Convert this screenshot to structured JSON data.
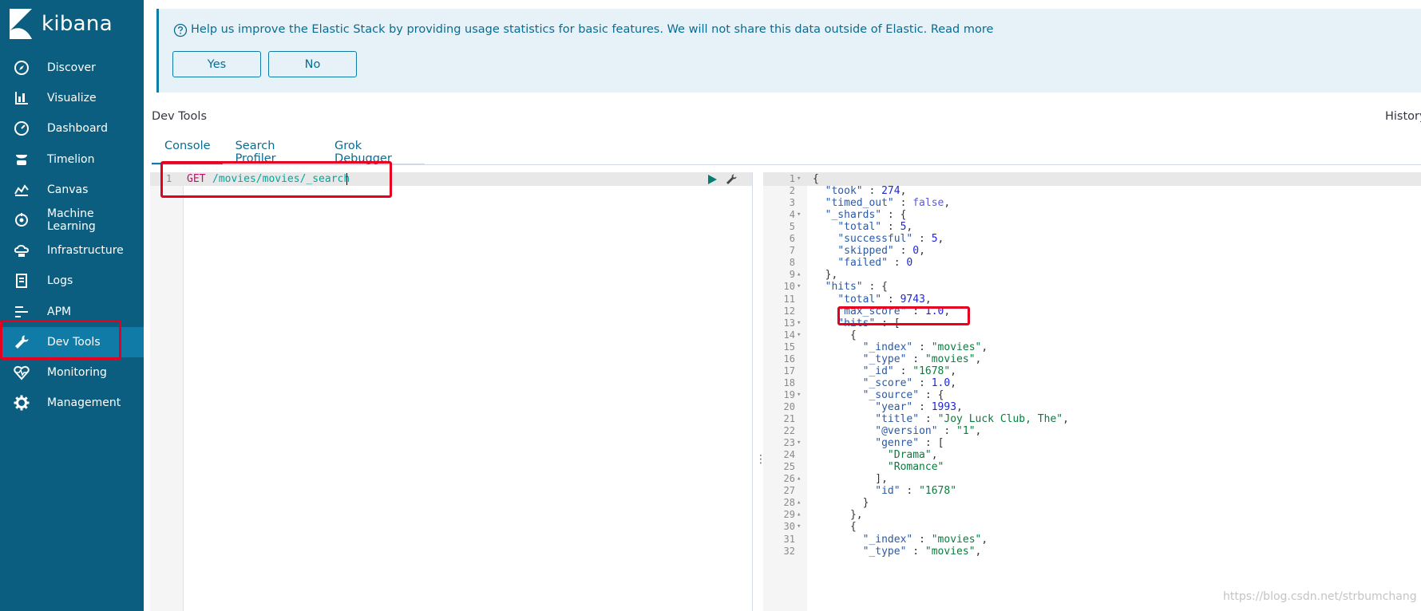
{
  "sidebar": {
    "brand": "kibana",
    "items": [
      {
        "label": "Discover",
        "icon": "compass-icon"
      },
      {
        "label": "Visualize",
        "icon": "bar-chart-icon"
      },
      {
        "label": "Dashboard",
        "icon": "gauge-icon"
      },
      {
        "label": "Timelion",
        "icon": "timelion-icon"
      },
      {
        "label": "Canvas",
        "icon": "canvas-icon"
      },
      {
        "label": "Machine Learning",
        "icon": "machine-learning-icon"
      },
      {
        "label": "Infrastructure",
        "icon": "infrastructure-icon"
      },
      {
        "label": "Logs",
        "icon": "logs-icon"
      },
      {
        "label": "APM",
        "icon": "apm-icon"
      },
      {
        "label": "Dev Tools",
        "icon": "wrench-icon",
        "active": true
      },
      {
        "label": "Monitoring",
        "icon": "heartbeat-icon"
      },
      {
        "label": "Management",
        "icon": "gear-icon"
      }
    ]
  },
  "banner": {
    "message": "Help us improve the Elastic Stack by providing usage statistics for basic features. We will not share this data outside of Elastic. Read more",
    "yes_label": "Yes",
    "no_label": "No"
  },
  "header": {
    "title": "Dev Tools",
    "history_label": "History"
  },
  "tabs": [
    "Console",
    "Search Profiler",
    "Grok Debugger"
  ],
  "request": {
    "line_number": "1",
    "method": "GET",
    "path": "/movies/movies/_search"
  },
  "response_lines": [
    "{",
    "  \"took\" : 274,",
    "  \"timed_out\" : false,",
    "  \"_shards\" : {",
    "    \"total\" : 5,",
    "    \"successful\" : 5,",
    "    \"skipped\" : 0,",
    "    \"failed\" : 0",
    "  },",
    "  \"hits\" : {",
    "    \"total\" : 9743,",
    "    \"max_score\" : 1.0,",
    "    \"hits\" : [",
    "      {",
    "        \"_index\" : \"movies\",",
    "        \"_type\" : \"movies\",",
    "        \"_id\" : \"1678\",",
    "        \"_score\" : 1.0,",
    "        \"_source\" : {",
    "          \"year\" : 1993,",
    "          \"title\" : \"Joy Luck Club, The\",",
    "          \"@version\" : \"1\",",
    "          \"genre\" : [",
    "            \"Drama\",",
    "            \"Romance\"",
    "          ],",
    "          \"id\" : \"1678\"",
    "        }",
    "      },",
    "      {",
    "        \"_index\" : \"movies\",",
    "        \"_type\" : \"movies\","
  ],
  "fold_markers": {
    "1": "down",
    "4": "down",
    "9": "up",
    "10": "down",
    "13": "down",
    "14": "down",
    "19": "down",
    "23": "down",
    "26": "up",
    "28": "up",
    "29": "up",
    "30": "down"
  },
  "watermark": "https://blog.csdn.net/strbumchang"
}
